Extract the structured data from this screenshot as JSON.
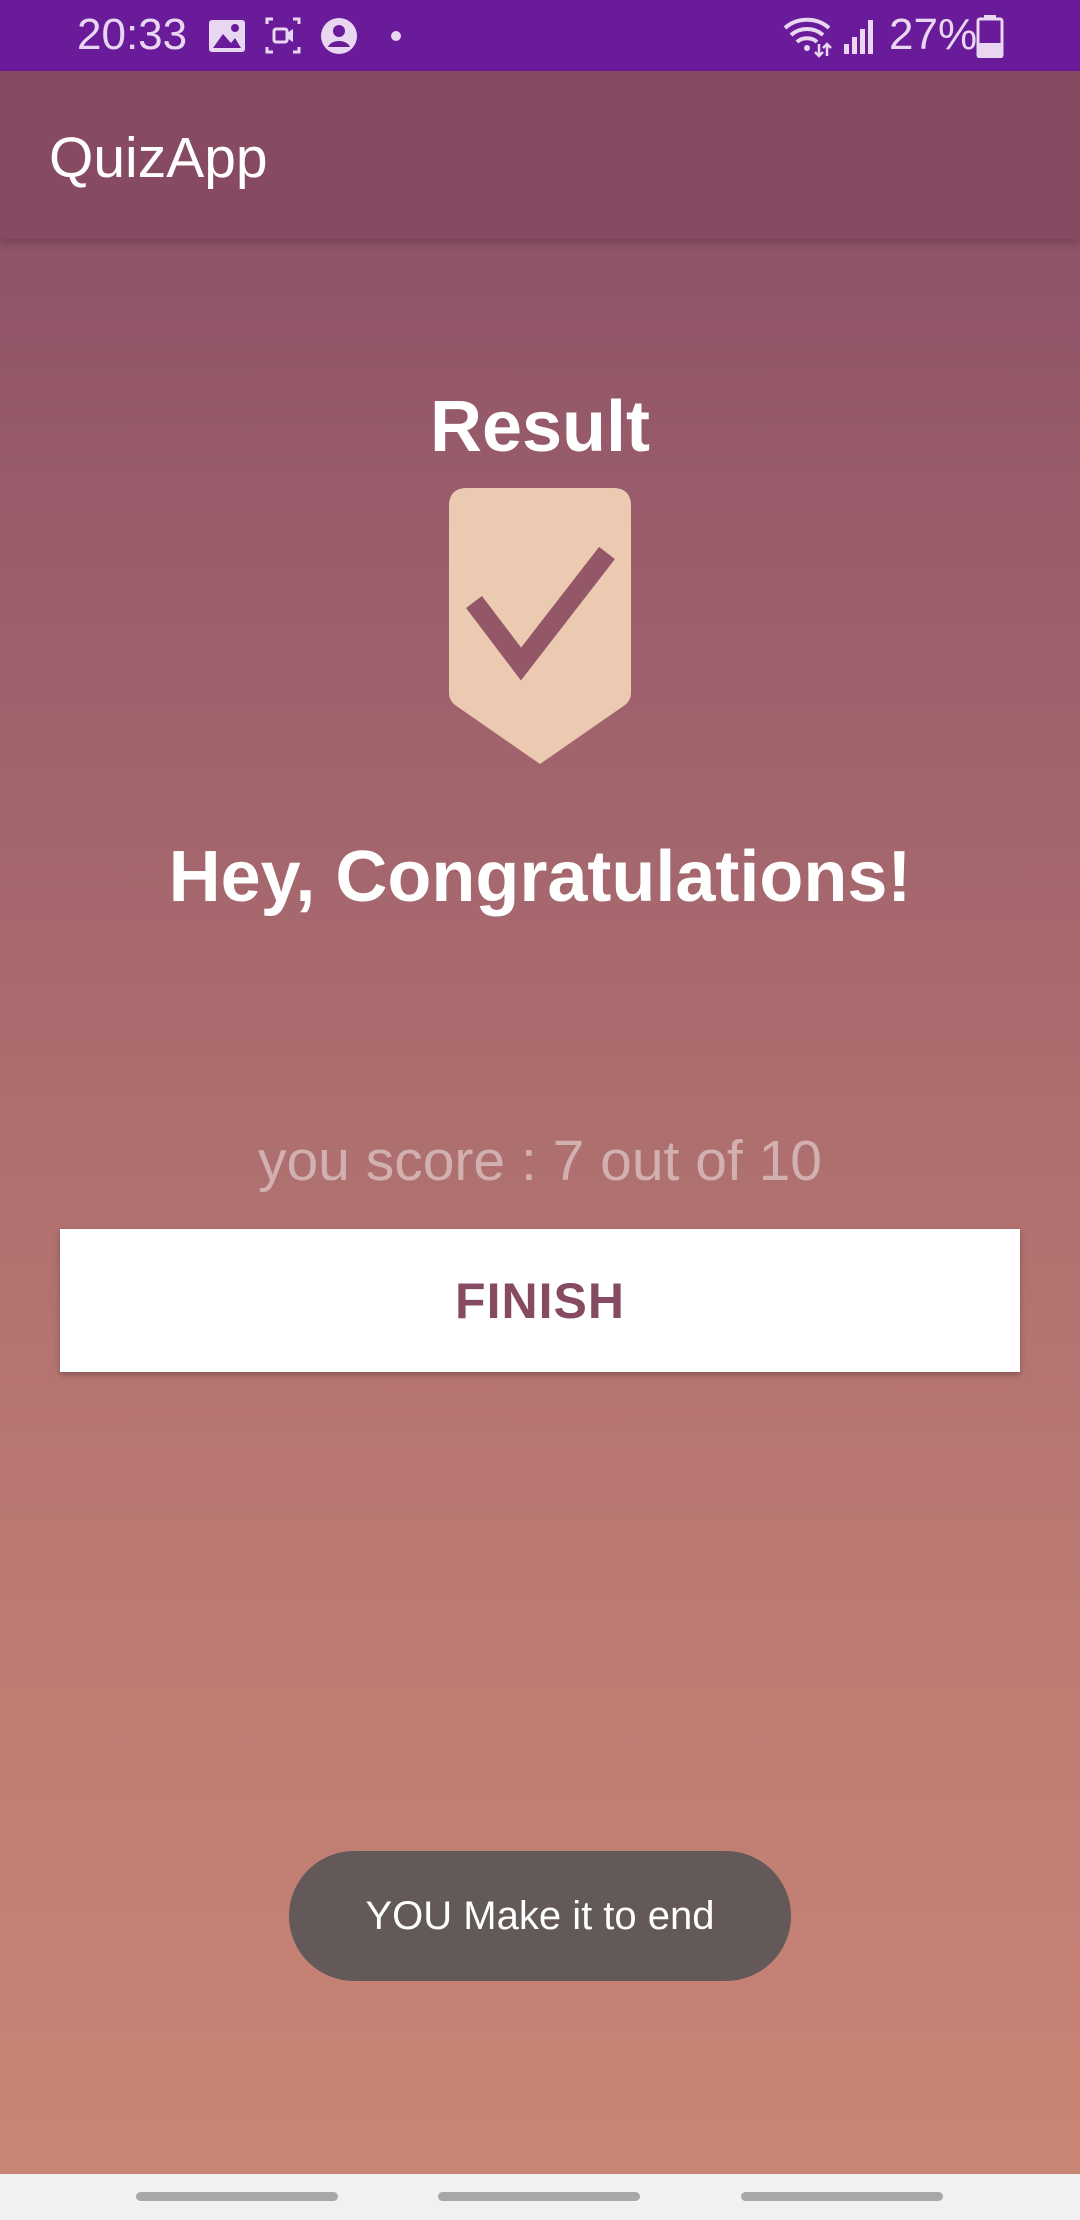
{
  "status_bar": {
    "time": "20:33",
    "battery_percent": "27%",
    "icons_left": [
      "image-icon",
      "screen-record-icon",
      "account-circle-icon",
      "notification-dot-icon"
    ],
    "icons_right": [
      "wifi-icon",
      "signal-icon",
      "battery-icon"
    ],
    "background_color": "#6a1b9a"
  },
  "app_bar": {
    "title": "QuizApp",
    "background_color": "#864b62"
  },
  "result": {
    "title": "Result",
    "icon": "badge-check-icon",
    "icon_color": "#eccab2",
    "congratulations": "Hey, Congratulations!",
    "score_text": "you score : 7 out of 10"
  },
  "finish_button": {
    "label": "FINISH",
    "text_color": "#864b62"
  },
  "toast": {
    "message": "YOU Make it to end"
  },
  "nav_bar": {
    "items": [
      "recents-pill",
      "home-pill",
      "back-pill"
    ]
  }
}
